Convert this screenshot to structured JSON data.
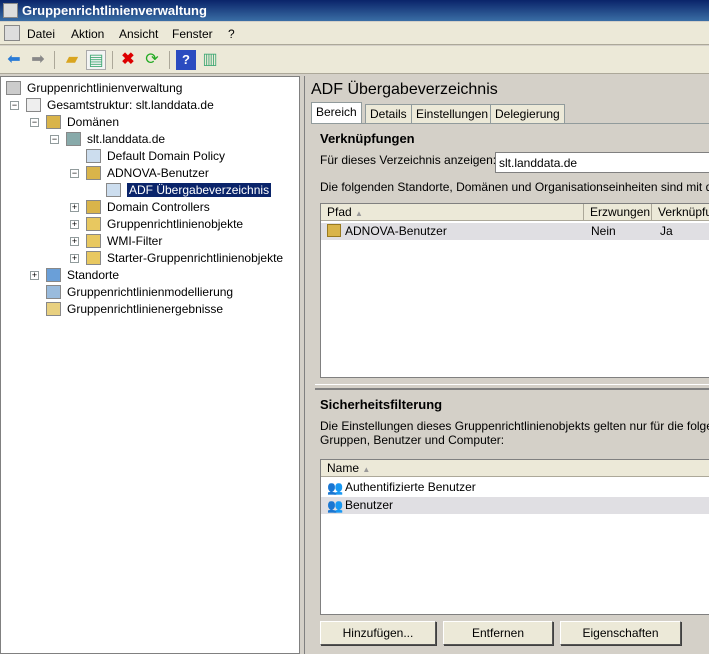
{
  "window": {
    "title": "Gruppenrichtlinienverwaltung"
  },
  "menu": [
    "Datei",
    "Aktion",
    "Ansicht",
    "Fenster",
    "?"
  ],
  "toolbar": [
    "back-icon",
    "forward-icon",
    "up-folder-icon",
    "show-hide-tree-icon",
    "delete-icon",
    "refresh-icon",
    "help-icon",
    "action-pane-icon"
  ],
  "tree": [
    {
      "label": "Gruppenrichtlinienverwaltung",
      "level": 0,
      "icon": "gpmc-icon",
      "expander": ""
    },
    {
      "label": "Gesamtstruktur: slt.landdata.de",
      "level": 1,
      "icon": "forest-icon",
      "expander": "−"
    },
    {
      "label": "Domänen",
      "level": 2,
      "icon": "domains-icon",
      "expander": "−"
    },
    {
      "label": "slt.landdata.de",
      "level": 3,
      "icon": "domain-icon",
      "expander": "−"
    },
    {
      "label": "Default Domain Policy",
      "level": 4,
      "icon": "gpo-link-icon",
      "expander": ""
    },
    {
      "label": "ADNOVA-Benutzer",
      "level": 4,
      "icon": "ou-icon",
      "expander": "−"
    },
    {
      "label": "ADF Übergabeverzeichnis",
      "level": 5,
      "icon": "gpo-link-icon",
      "expander": "",
      "selected": true
    },
    {
      "label": "Domain Controllers",
      "level": 4,
      "icon": "ou-icon",
      "expander": "+"
    },
    {
      "label": "Gruppenrichtlinienobjekte",
      "level": 4,
      "icon": "folder-icon",
      "expander": "+"
    },
    {
      "label": "WMI-Filter",
      "level": 4,
      "icon": "folder-icon",
      "expander": "+"
    },
    {
      "label": "Starter-Gruppenrichtlinienobjekte",
      "level": 4,
      "icon": "folder-icon",
      "expander": "+"
    },
    {
      "label": "Standorte",
      "level": 2,
      "icon": "sites-icon",
      "expander": "+"
    },
    {
      "label": "Gruppenrichtlinienmodellierung",
      "level": 2,
      "icon": "modeling-icon",
      "expander": ""
    },
    {
      "label": "Gruppenrichtlinienergebnisse",
      "level": 2,
      "icon": "results-icon",
      "expander": ""
    }
  ],
  "right": {
    "title": "ADF Übergabeverzeichnis",
    "tabs": [
      "Bereich",
      "Details",
      "Einstellungen",
      "Delegierung"
    ],
    "links": {
      "heading": "Verknüpfungen",
      "show_label": "Für dieses Verzeichnis anzeigen:",
      "show_value": "slt.landdata.de",
      "desc": "Die folgenden Standorte, Domänen und Organisationseinheiten sind mit dem O",
      "columns": [
        "Pfad",
        "Erzwungen",
        "Verknüpfu"
      ],
      "rows": [
        {
          "path": "ADNOVA-Benutzer",
          "enforced": "Nein",
          "linked": "Ja"
        }
      ]
    },
    "security": {
      "heading": "Sicherheitsfilterung",
      "desc1": "Die Einstellungen dieses Gruppenrichtlinienobjekts gelten nur für die folgenden",
      "desc2": "Gruppen, Benutzer und Computer:",
      "column": "Name",
      "rows": [
        "Authentifizierte Benutzer",
        "Benutzer"
      ],
      "buttons": [
        "Hinzufügen...",
        "Entfernen",
        "Eigenschaften"
      ]
    }
  }
}
